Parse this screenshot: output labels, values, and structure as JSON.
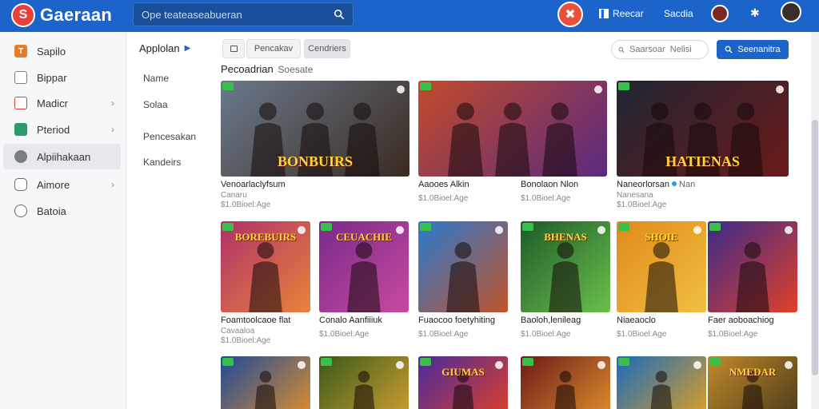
{
  "header": {
    "logo_text": "Gaeraan",
    "search_placeholder": "Ope teateaseabueran",
    "links": [
      {
        "label": "Reecar",
        "icon": "bookmark-icon"
      },
      {
        "label": "Sacdia"
      }
    ]
  },
  "sidebar": {
    "items": [
      {
        "label": "Sapilo",
        "icon_color": "#e87b2a",
        "chevron": false
      },
      {
        "label": "Bippar",
        "icon_color": "#7c7f86",
        "chevron": false
      },
      {
        "label": "Madicr",
        "icon_color": "#d8413a",
        "chevron": true
      },
      {
        "label": "Pteriod",
        "icon_color": "#2a9b6c",
        "chevron": true
      },
      {
        "label": "Alpiihakaan",
        "icon_color": "#7a7d84",
        "chevron": false,
        "active": true
      },
      {
        "label": "Aimore",
        "icon_color": "#666a70",
        "chevron": true
      },
      {
        "label": "Batoia",
        "icon_color": "#666a70",
        "chevron": false
      }
    ]
  },
  "categories": {
    "title": "Applolan",
    "items": [
      "Name",
      "Solaa",
      "Pencesakan",
      "Kandeirs"
    ]
  },
  "toolbar": {
    "tabs": [
      "",
      "Pencakav",
      "Cendriers"
    ],
    "search_placeholder": "Saarsoar  Nelisi",
    "primary_label": "Seenanitra"
  },
  "section": {
    "title": "Pecoadrian",
    "subtitle": "Soesate"
  },
  "cards": [
    {
      "title": "Venoarlaclyfsum",
      "meta1": "Canaru",
      "meta2": "$1.0Bioel:Age",
      "art": "BONBUIRS",
      "bg1": "#6b7a8c",
      "bg2": "#3a2a20",
      "accent": "#ffd43a"
    },
    {
      "title": "Aaooes Alkin",
      "meta1": "",
      "meta2": "$1.0Bioel:Age",
      "art": "",
      "bg1": "#c24b2a",
      "bg2": "#5a2a80",
      "accent": "#ffd43a"
    },
    {
      "title": "Bonolaon Nlon",
      "meta1": "",
      "meta2": "$1.0Bioel:Age",
      "art": "",
      "bg1": "#d06a2a",
      "bg2": "#3a5a30",
      "accent": "#ffd43a"
    },
    {
      "title": "Naneorlorsan",
      "verified_text": "Nan",
      "meta1": "Nanesana",
      "meta2": "$1.0Bioel:Age",
      "art": "HATIENAS",
      "bg1": "#202634",
      "bg2": "#6a1a1a",
      "accent": "#ffd43a"
    },
    {
      "title": "Foamtoolcaoe flat",
      "meta1": "Cavaaloa",
      "meta2": "$1.0Bioel:Age",
      "art": "BOREBUIRS",
      "bg1": "#b0306a",
      "bg2": "#e8843a",
      "accent": "#ffd43a"
    },
    {
      "title": "Conalo Aanfiiiuk",
      "meta1": "",
      "meta2": "$1.0Bioel:Age",
      "art": "CEUACHIE",
      "bg1": "#7a2a8a",
      "bg2": "#c84aa0",
      "accent": "#ffd43a"
    },
    {
      "title": "Fuaocoo foetyhiting",
      "meta1": "",
      "meta2": "$1.0Bioel:Age",
      "art": "",
      "bg1": "#2a7ad0",
      "bg2": "#c0542a",
      "accent": "#ffd43a"
    },
    {
      "title": "Baoloh,lenileag",
      "meta1": "",
      "meta2": "$1.0Bioel:Age",
      "art": "BHENAS",
      "bg1": "#1e5a2a",
      "bg2": "#6ac04a",
      "accent": "#ffd43a"
    },
    {
      "title": "Niaeaoclo",
      "meta1": "",
      "meta2": "$1.0Bioel:Age",
      "art": "SHOIE",
      "bg1": "#e08a1a",
      "bg2": "#f0c040",
      "accent": "#ffd43a"
    },
    {
      "title": "Faer aoboachiog",
      "meta1": "",
      "meta2": "$1.0Bioel:Age",
      "art": "",
      "bg1": "#3a2a8a",
      "bg2": "#e0402a",
      "accent": "#ffd43a"
    },
    {
      "title": "",
      "meta1": "",
      "meta2": "",
      "art": "",
      "bg1": "#1e4a9a",
      "bg2": "#e0902a",
      "accent": "#ffd43a"
    },
    {
      "title": "",
      "meta1": "",
      "meta2": "",
      "art": "",
      "bg1": "#3a5a1a",
      "bg2": "#d0a030",
      "accent": "#ffd43a"
    },
    {
      "title": "",
      "meta1": "",
      "meta2": "",
      "art": "GIUMAS",
      "bg1": "#4a2a9a",
      "bg2": "#e0402a",
      "accent": "#ffd43a"
    },
    {
      "title": "",
      "meta1": "",
      "meta2": "",
      "art": "",
      "bg1": "#6a1a1a",
      "bg2": "#e0902a",
      "accent": "#ffd43a"
    },
    {
      "title": "",
      "meta1": "",
      "meta2": "",
      "art": "",
      "bg1": "#1a6ac0",
      "bg2": "#e0a020",
      "accent": "#ffd43a"
    },
    {
      "title": "",
      "meta1": "",
      "meta2": "",
      "art": "NMEDAR",
      "bg1": "#c08a2a",
      "bg2": "#4a3a1a",
      "accent": "#ffd43a"
    }
  ]
}
